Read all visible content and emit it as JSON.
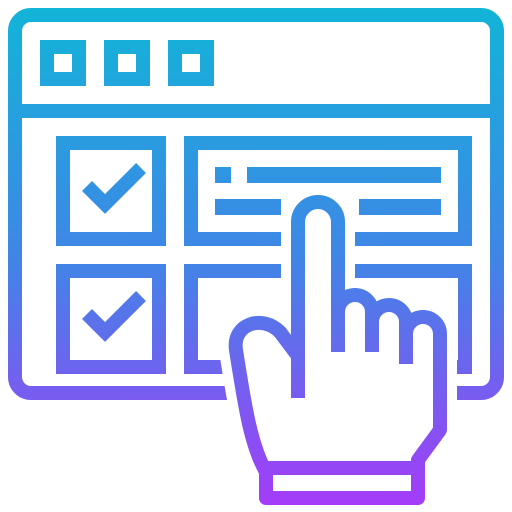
{
  "icon": {
    "name": "browser-checklist-touch-icon",
    "gradient_top": "#12b4d8",
    "gradient_mid": "#3f86e6",
    "gradient_bottom": "#a43cf8"
  }
}
